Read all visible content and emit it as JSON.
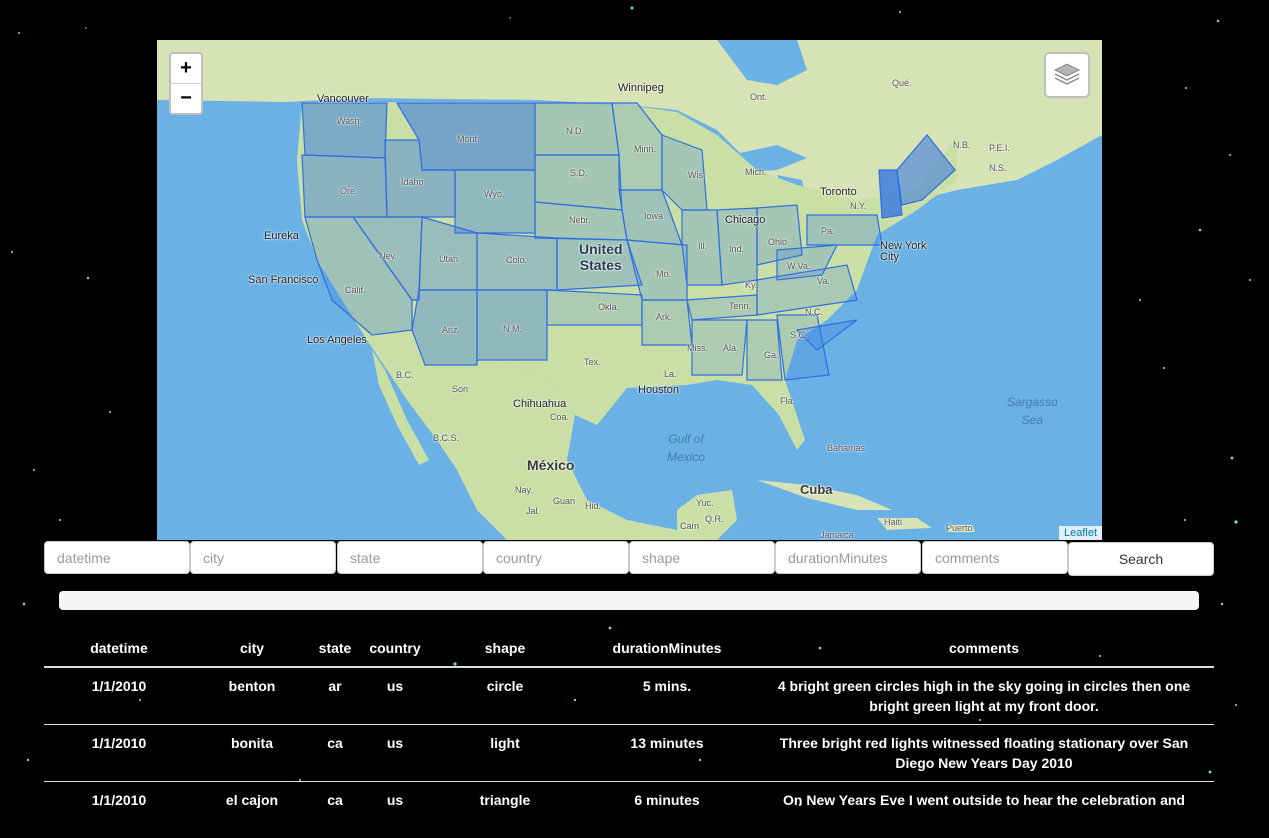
{
  "map": {
    "zoom_in": "+",
    "zoom_out": "−",
    "attribution": "Leaflet",
    "labels": {
      "vancouver": "Vancouver",
      "winnipeg": "Winnipeg",
      "que": "Qué.",
      "ont": "Ont.",
      "nb": "N.B.",
      "pei": "P.E.I.",
      "ns": "N.S.",
      "toronto": "Toronto",
      "chicago": "Chicago",
      "new_york_1": "New York",
      "new_york_2": "City",
      "eureka": "Eureka",
      "san_francisco": "San Francisco",
      "los_angeles": "Los Angeles",
      "united_1": "United",
      "united_2": "States",
      "houston": "Houston",
      "chihuahua": "Chihuahua",
      "mexico": "México",
      "gulf_1": "Gulf of",
      "gulf_2": "Mexico",
      "cuba": "Cuba",
      "bahamas": "Bahamas",
      "sargasso_1": "Sargasso",
      "sargasso_2": "Sea",
      "haiti": "Haiti",
      "puerto_1": "Puerto",
      "jamaica": "Jamaica",
      "wash": "Wash.",
      "mont": "Mont.",
      "nd": "N.D.",
      "minn": "Minn.",
      "ore": "Ore.",
      "idaho": "Idaho",
      "wyo": "Wyo.",
      "sd": "S.D.",
      "wis": "Wis.",
      "mich": "Mich.",
      "nebr": "Nebr.",
      "iowa": "Iowa",
      "nev": "Nev.",
      "utah": "Utah",
      "colo": "Colo.",
      "ill": "Ill.",
      "ind": "Ind.",
      "ohio": "Ohio",
      "pa": "Pa.",
      "ny": "N.Y.",
      "calif": "Calif.",
      "mo": "Mo.",
      "wva": "W.Va.",
      "va": "Va.",
      "ky": "Ky.",
      "tenn": "Tenn.",
      "nc": "N.C.",
      "okla": "Okla.",
      "ark": "Ark.",
      "sc": "S.C.",
      "ariz": "Ariz.",
      "nm": "N.M.",
      "miss": "Miss.",
      "ala": "Ala.",
      "ga": "Ga.",
      "tex": "Tex.",
      "la": "La.",
      "fla": "Fla.",
      "bc": "B.C.",
      "son": "Son",
      "coa": "Coa.",
      "bcs": "B.C.S.",
      "nay": "Nay.",
      "guan": "Guan",
      "jal": "Jal.",
      "hid": "Hid.",
      "yuc": "Yuc.",
      "qr": "Q.R.",
      "cam": "Cam"
    }
  },
  "filters": {
    "datetime": "datetime",
    "city": "city",
    "state": "state",
    "country": "country",
    "shape": "shape",
    "duration": "durationMinutes",
    "comments": "comments",
    "search": "Search"
  },
  "table": {
    "headers": [
      "datetime",
      "city",
      "state",
      "country",
      "shape",
      "durationMinutes",
      "comments"
    ],
    "rows": [
      [
        "1/1/2010",
        "benton",
        "ar",
        "us",
        "circle",
        "5 mins.",
        "4 bright green circles high in the sky going in circles then one bright green light at my front door."
      ],
      [
        "1/1/2010",
        "bonita",
        "ca",
        "us",
        "light",
        "13 minutes",
        "Three bright red lights witnessed floating stationary over San Diego New Years Day 2010"
      ],
      [
        "1/1/2010",
        "el cajon",
        "ca",
        "us",
        "triangle",
        "6 minutes",
        "On New Years Eve I went outside to hear the celebration and"
      ]
    ]
  },
  "colors": {
    "background": "#000000",
    "water": "#6ab1e6",
    "land": "#c9dfa6",
    "state_fill": "#3d7de0",
    "state_highlight": "#1f6bff",
    "link": "#0078a8"
  }
}
